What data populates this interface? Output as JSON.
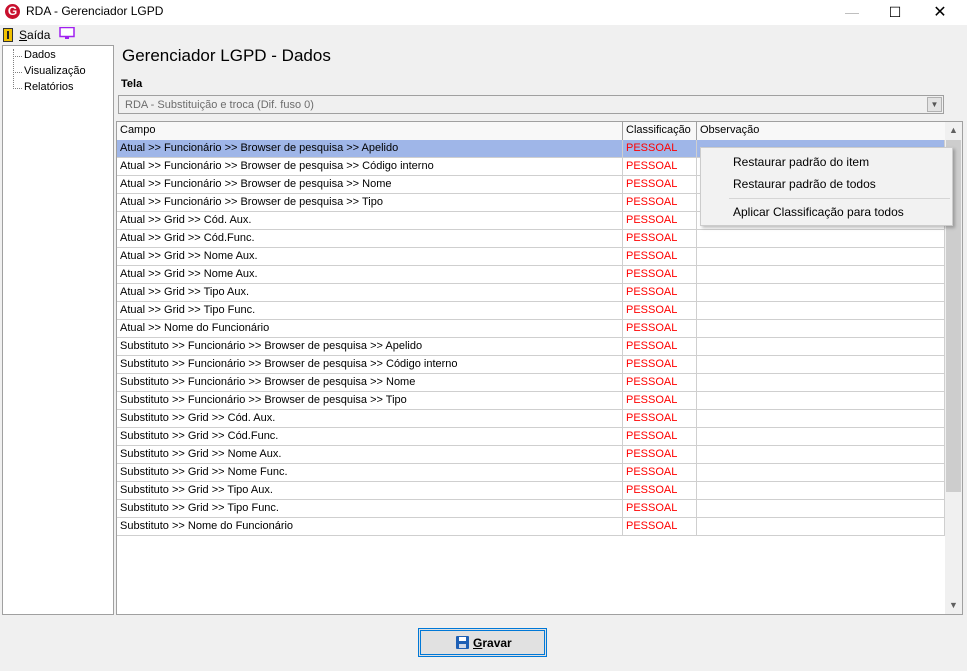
{
  "window": {
    "title": "RDA - Gerenciador LGPD",
    "logo_letter": "G"
  },
  "toolbar": {
    "exit_underlined": "S",
    "exit_rest": "aída"
  },
  "sidebar": {
    "items": [
      {
        "label": "Dados"
      },
      {
        "label": "Visualização"
      },
      {
        "label": "Relatórios"
      }
    ]
  },
  "main": {
    "title": "Gerenciador LGPD - Dados",
    "screen_label": "Tela",
    "screen_value": "RDA - Substituição e troca (Dif. fuso 0)"
  },
  "grid": {
    "columns": [
      "Campo",
      "Classificação",
      "Observação"
    ],
    "rows": [
      {
        "campo": "Atual >> Funcionário >> Browser de pesquisa >> Apelido",
        "classificacao": "PESSOAL",
        "observacao": ""
      },
      {
        "campo": "Atual >> Funcionário >> Browser de pesquisa >> Código interno",
        "classificacao": "PESSOAL",
        "observacao": ""
      },
      {
        "campo": "Atual >> Funcionário >> Browser de pesquisa >> Nome",
        "classificacao": "PESSOAL",
        "observacao": ""
      },
      {
        "campo": "Atual >> Funcionário >> Browser de pesquisa >> Tipo",
        "classificacao": "PESSOAL",
        "observacao": ""
      },
      {
        "campo": "Atual >> Grid >> Cód. Aux.",
        "classificacao": "PESSOAL",
        "observacao": ""
      },
      {
        "campo": "Atual >> Grid >> Cód.Func.",
        "classificacao": "PESSOAL",
        "observacao": ""
      },
      {
        "campo": "Atual >> Grid >> Nome Aux.",
        "classificacao": "PESSOAL",
        "observacao": ""
      },
      {
        "campo": "Atual >> Grid >> Nome Aux.",
        "classificacao": "PESSOAL",
        "observacao": ""
      },
      {
        "campo": "Atual >> Grid >> Tipo Aux.",
        "classificacao": "PESSOAL",
        "observacao": ""
      },
      {
        "campo": "Atual >> Grid >> Tipo Func.",
        "classificacao": "PESSOAL",
        "observacao": ""
      },
      {
        "campo": "Atual >> Nome do Funcionário",
        "classificacao": "PESSOAL",
        "observacao": ""
      },
      {
        "campo": "Substituto >> Funcionário >> Browser de pesquisa >> Apelido",
        "classificacao": "PESSOAL",
        "observacao": ""
      },
      {
        "campo": "Substituto >> Funcionário >> Browser de pesquisa >> Código interno",
        "classificacao": "PESSOAL",
        "observacao": ""
      },
      {
        "campo": "Substituto >> Funcionário >> Browser de pesquisa >> Nome",
        "classificacao": "PESSOAL",
        "observacao": ""
      },
      {
        "campo": "Substituto >> Funcionário >> Browser de pesquisa >> Tipo",
        "classificacao": "PESSOAL",
        "observacao": ""
      },
      {
        "campo": "Substituto >> Grid >> Cód. Aux.",
        "classificacao": "PESSOAL",
        "observacao": ""
      },
      {
        "campo": "Substituto >> Grid >> Cód.Func.",
        "classificacao": "PESSOAL",
        "observacao": ""
      },
      {
        "campo": "Substituto >> Grid >> Nome Aux.",
        "classificacao": "PESSOAL",
        "observacao": ""
      },
      {
        "campo": "Substituto >> Grid >> Nome Func.",
        "classificacao": "PESSOAL",
        "observacao": ""
      },
      {
        "campo": "Substituto >> Grid >> Tipo Aux.",
        "classificacao": "PESSOAL",
        "observacao": ""
      },
      {
        "campo": "Substituto >> Grid >> Tipo Func.",
        "classificacao": "PESSOAL",
        "observacao": ""
      },
      {
        "campo": "Substituto >> Nome do Funcionário",
        "classificacao": "PESSOAL",
        "observacao": ""
      }
    ]
  },
  "context_menu": {
    "items": [
      {
        "label": "Restaurar padrão do item"
      },
      {
        "label": "Restaurar padrão de todos"
      },
      {
        "label": "Aplicar Classificação para todos"
      }
    ]
  },
  "footer": {
    "save_underlined": "G",
    "save_rest": "ravar"
  },
  "colors": {
    "selection": "#9fb6e8",
    "classification_text": "#ff0000",
    "accent": "#0078d7"
  }
}
